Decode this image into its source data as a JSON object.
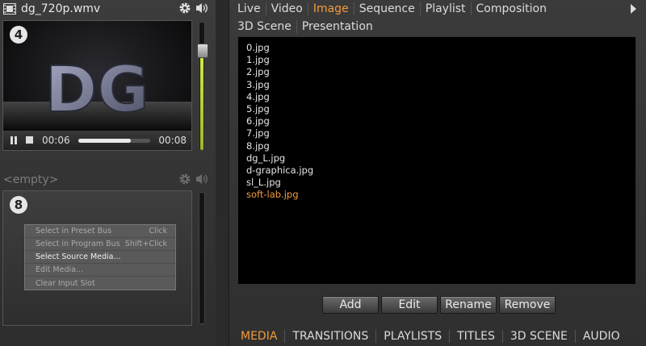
{
  "slot1": {
    "title": "dg_720p.wmv",
    "number": "4",
    "time_current": "00:06",
    "time_total": "00:08",
    "progress": 0.73,
    "volume": 0.78,
    "thumb_text": "DG"
  },
  "slot2": {
    "title": "<empty>",
    "number": "8",
    "volume": 0.0
  },
  "context_menu": [
    {
      "label": "Select in Preset Bus",
      "shortcut": "Click",
      "enabled": false
    },
    {
      "label": "Select in Program Bus",
      "shortcut": "Shift+Click",
      "enabled": false
    },
    {
      "label": "Select Source Media...",
      "shortcut": "",
      "enabled": true
    },
    {
      "label": "Edit Media...",
      "shortcut": "",
      "enabled": false
    },
    {
      "label": "Clear Input Slot",
      "shortcut": "",
      "enabled": false
    }
  ],
  "tabs_row1": [
    "Live",
    "Video",
    "Image",
    "Sequence",
    "Playlist",
    "Composition"
  ],
  "tabs_row2": [
    "3D Scene",
    "Presentation"
  ],
  "active_tab": "Image",
  "files": [
    "0.jpg",
    "1.jpg",
    "2.jpg",
    "3.jpg",
    "4.jpg",
    "5.jpg",
    "6.jpg",
    "7.jpg",
    "8.jpg",
    "dg_L.jpg",
    "d-graphica.jpg",
    "sl_L.jpg",
    "soft-lab.jpg"
  ],
  "selected_file": "soft-lab.jpg",
  "buttons": {
    "add": "Add",
    "edit": "Edit",
    "rename": "Rename",
    "remove": "Remove"
  },
  "bottom_tabs": [
    "MEDIA",
    "TRANSITIONS",
    "PLAYLISTS",
    "TITLES",
    "3D SCENE",
    "AUDIO"
  ],
  "active_bottom_tab": "MEDIA",
  "colors": {
    "accent": "#f39a3a",
    "volume": "#c8dc40"
  }
}
